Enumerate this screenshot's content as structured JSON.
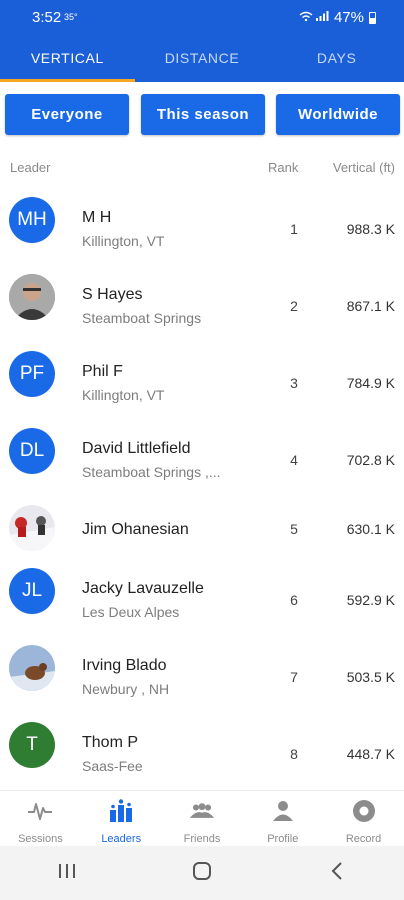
{
  "status": {
    "time": "3:52",
    "temp": "35°",
    "battery": "47%"
  },
  "tabs": [
    {
      "label": "VERTICAL",
      "active": true
    },
    {
      "label": "DISTANCE",
      "active": false
    },
    {
      "label": "DAYS",
      "active": false
    }
  ],
  "filters": {
    "audience": "Everyone",
    "period": "This season",
    "region": "Worldwide"
  },
  "columns": {
    "leader": "Leader",
    "rank": "Rank",
    "value": "Vertical (ft)"
  },
  "leaders": [
    {
      "initials": "MH",
      "name": "M H",
      "location": "Killington, VT",
      "rank": "1",
      "value": "988.3 K",
      "avatar": "initials",
      "color": "#1a6ae8"
    },
    {
      "initials": "",
      "name": "S Hayes",
      "location": "Steamboat Springs",
      "rank": "2",
      "value": "867.1 K",
      "avatar": "photo"
    },
    {
      "initials": "PF",
      "name": "Phil F",
      "location": "Killington, VT",
      "rank": "3",
      "value": "784.9 K",
      "avatar": "initials",
      "color": "#1a6ae8"
    },
    {
      "initials": "DL",
      "name": "David Littlefield",
      "location": "Steamboat Springs ,...",
      "rank": "4",
      "value": "702.8 K",
      "avatar": "initials",
      "color": "#1a6ae8"
    },
    {
      "initials": "",
      "name": "Jim Ohanesian",
      "location": "",
      "rank": "5",
      "value": "630.1 K",
      "avatar": "photo"
    },
    {
      "initials": "JL",
      "name": "Jacky Lavauzelle",
      "location": "Les Deux Alpes",
      "rank": "6",
      "value": "592.9 K",
      "avatar": "initials",
      "color": "#1a6ae8"
    },
    {
      "initials": "",
      "name": "Irving Blado",
      "location": "Newbury , NH",
      "rank": "7",
      "value": "503.5 K",
      "avatar": "photo"
    },
    {
      "initials": "T",
      "name": "Thom P",
      "location": "Saas-Fee",
      "rank": "8",
      "value": "448.7 K",
      "avatar": "initials",
      "color": "#2e7d32"
    }
  ],
  "bottom_nav": [
    {
      "label": "Sessions",
      "icon": "pulse-icon",
      "active": false
    },
    {
      "label": "Leaders",
      "icon": "leaderboard-icon",
      "active": true
    },
    {
      "label": "Friends",
      "icon": "group-icon",
      "active": false
    },
    {
      "label": "Profile",
      "icon": "person-icon",
      "active": false
    },
    {
      "label": "Record",
      "icon": "record-icon",
      "active": false
    }
  ],
  "colors": {
    "primary": "#1a5fd8",
    "button": "#1a6ae8",
    "tab_indicator": "#f5a623"
  }
}
